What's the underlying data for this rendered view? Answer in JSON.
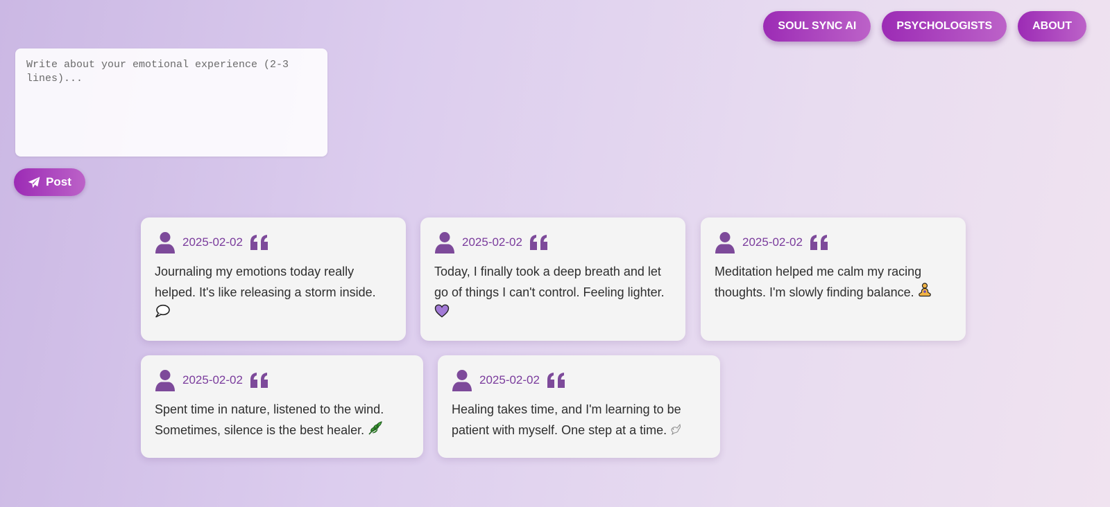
{
  "nav": {
    "items": [
      {
        "label": "SOUL SYNC AI"
      },
      {
        "label": "PSYCHOLOGISTS"
      },
      {
        "label": "ABOUT"
      }
    ]
  },
  "composer": {
    "placeholder": "Write about your emotional experience (2-3 lines)...",
    "post_label": "Post",
    "post_icon": "paper-plane-icon"
  },
  "posts": [
    {
      "date": "2025-02-02",
      "text": "Journaling my emotions today really helped. It's like releasing a storm inside.",
      "emoji": "speech-bubble-icon"
    },
    {
      "date": "2025-02-02",
      "text": "Today, I finally took a deep breath and let go of things I can't control. Feeling lighter.",
      "emoji": "purple-heart-icon"
    },
    {
      "date": "2025-02-02",
      "text": "Meditation helped me calm my racing thoughts. I'm slowly finding balance.",
      "emoji": "meditation-icon"
    },
    {
      "date": "2025-02-02",
      "text": "Spent time in nature, listened to the wind. Sometimes, silence is the best healer.",
      "emoji": "herb-icon"
    },
    {
      "date": "2025-02-02",
      "text": "Healing takes time, and I'm learning to be patient with myself. One step at a time.",
      "emoji": "dove-icon"
    }
  ],
  "colors": {
    "accent_start": "#9c2bb5",
    "accent_end": "#bc62c8",
    "date_text": "#7a3b9c",
    "icon": "#7d4a9a",
    "card_bg": "#f4f4f4"
  }
}
